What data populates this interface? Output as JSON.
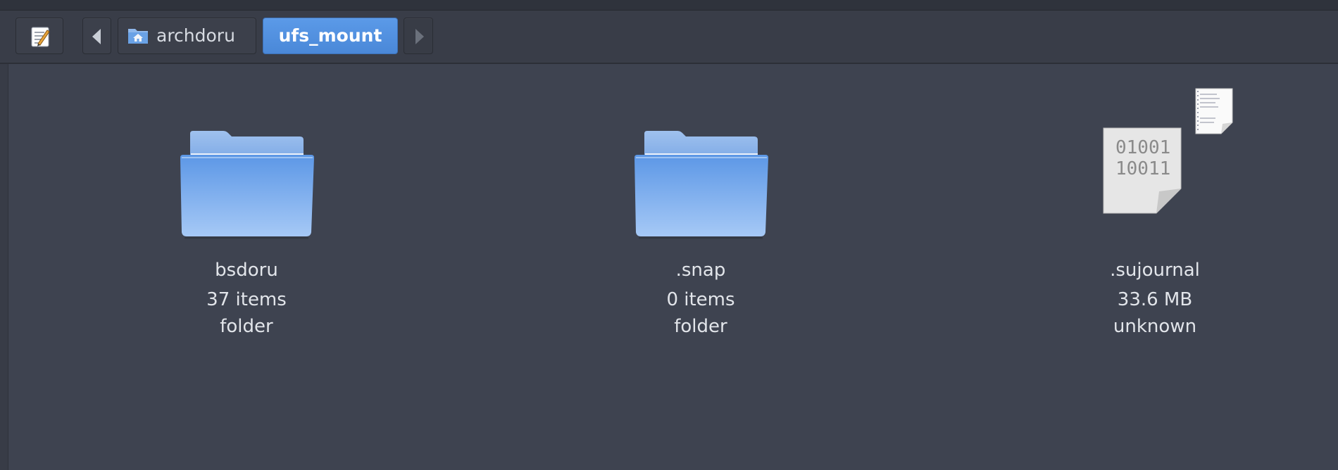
{
  "toolbar": {
    "breadcrumb": [
      {
        "label": "archdoru",
        "icon": "home-folder-icon"
      },
      {
        "label": "ufs_mount",
        "active": true
      }
    ]
  },
  "files": [
    {
      "name": "bsdoru",
      "size": "37 items",
      "type": "folder",
      "icon": "folder-icon"
    },
    {
      "name": ".snap",
      "size": "0 items",
      "type": "folder",
      "icon": "folder-icon"
    },
    {
      "name": ".sujournal",
      "size": "33.6 MB",
      "type": "unknown",
      "icon": "binary-file-icon"
    }
  ],
  "colors": {
    "background": "#3e4350",
    "toolbar": "#393d48",
    "accent": "#4a88d8",
    "text": "#e2e5ea"
  }
}
